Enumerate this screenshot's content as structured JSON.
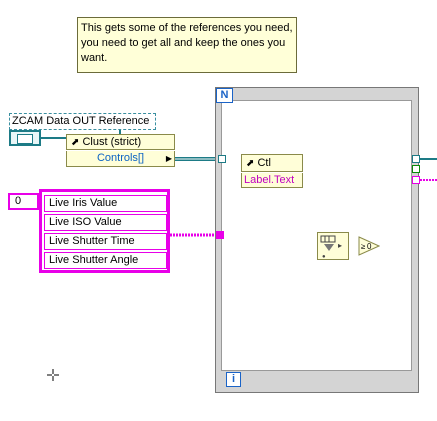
{
  "comment": {
    "text": "This gets some of the references you need, you need to get all and keep the ones you want."
  },
  "reference": {
    "label": "ZCAM Data OUT Reference"
  },
  "property_node": {
    "class_name": "Clust (strict)",
    "property": "Controls[]"
  },
  "string_array": {
    "index": "0",
    "items": [
      "Live Iris Value",
      "Live ISO Value",
      "Live Shutter Time",
      "Live Shutter Angle"
    ]
  },
  "for_loop": {
    "count_label": "N",
    "iteration_label": "i"
  },
  "cast_node": {
    "class_name": "Ctl",
    "property": "Label.Text"
  },
  "comparison": {
    "value": "0"
  },
  "colors": {
    "reference_wire": "#1d7b86",
    "string_wire": "#e800e8",
    "comment_bg": "#ffffd8",
    "property_text": "#0c63c4"
  },
  "icons": [
    "reference-icon",
    "property-node-icon",
    "search-1d-array-icon",
    "greater-or-equal-zero-icon",
    "crosshair-cursor-icon"
  ]
}
